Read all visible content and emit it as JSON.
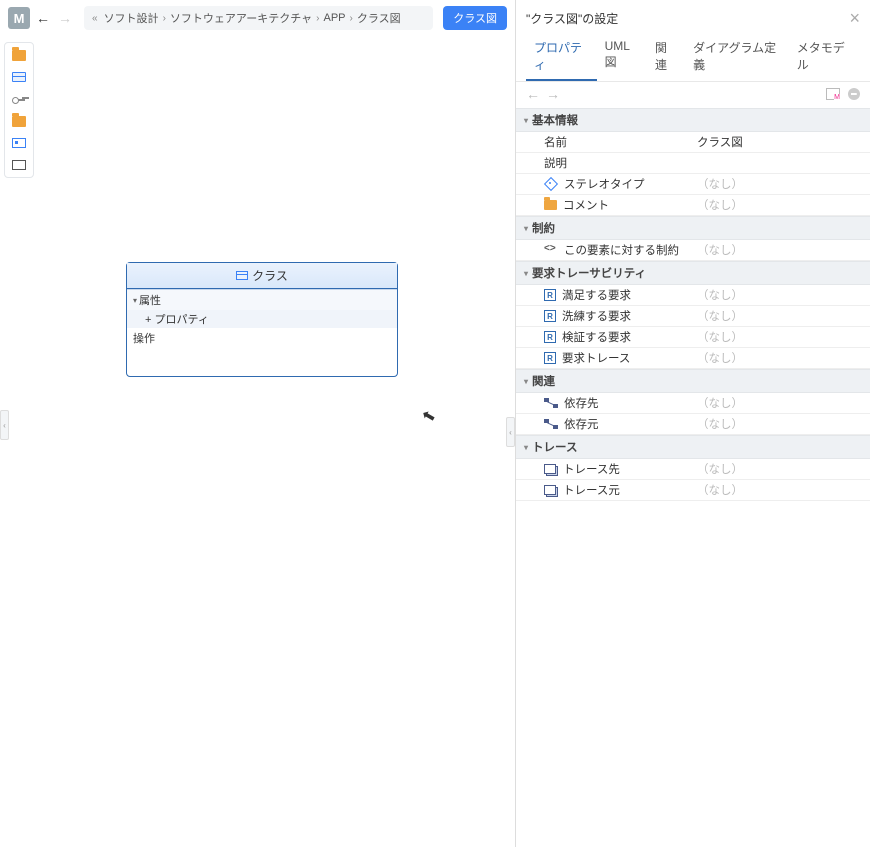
{
  "topbar": {
    "m_label": "M",
    "breadcrumb": [
      "ソフト設計",
      "ソフトウェアアーキテクチャ",
      "APP",
      "クラス図"
    ],
    "tag_label": "クラス図"
  },
  "canvas": {
    "class_name": "クラス",
    "attributes_label": "属性",
    "property_item": "+ プロパティ",
    "operations_label": "操作"
  },
  "panel": {
    "title": "\"クラス図\"の設定",
    "tabs": [
      "プロパティ",
      "UML図",
      "関連",
      "ダイアグラム定義",
      "メタモデル"
    ],
    "placeholder_none": "（なし）",
    "sections": {
      "basic": {
        "title": "基本情報",
        "name_label": "名前",
        "name_value": "クラス図",
        "desc_label": "説明",
        "stereo_label": "ステレオタイプ",
        "comment_label": "コメント"
      },
      "constraint": {
        "title": "制約",
        "row1": "この要素に対する制約"
      },
      "trace_req": {
        "title": "要求トレーサビリティ",
        "r1": "満足する要求",
        "r2": "洗練する要求",
        "r3": "検証する要求",
        "r4": "要求トレース"
      },
      "relation": {
        "title": "関連",
        "r1": "依存先",
        "r2": "依存元"
      },
      "trace": {
        "title": "トレース",
        "r1": "トレース先",
        "r2": "トレース元"
      }
    }
  }
}
